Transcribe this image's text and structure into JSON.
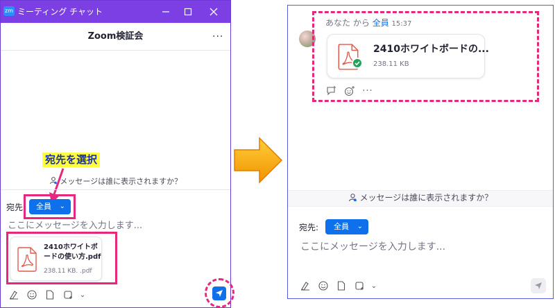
{
  "left_window": {
    "app_logo": "zm",
    "title": "ミーティング チャット",
    "window_controls": {
      "minimize": "–",
      "maximize": "□",
      "close": "✕"
    },
    "chat_title": "Zoom検証会",
    "more_menu": "···",
    "callout": "宛先を選択",
    "visibility_prompt": "メッセージは誰に表示されますか？",
    "to_label": "宛先:",
    "recipient": "全員",
    "input_placeholder": "ここにメッセージを入力します...",
    "file": {
      "name": "2410ホワイトボードの使い方.pdf",
      "meta": "238.11 KB. .pdf"
    }
  },
  "right_panel": {
    "sender": "あなた",
    "from": "から",
    "recipient": "全員",
    "time": "15:37",
    "file": {
      "name": "2410ホワイトボードの...",
      "meta": "238.11 KB"
    },
    "visibility_prompt": "メッセージは誰に表示されますか？",
    "to_label": "宛先:",
    "recipient_button": "全員",
    "input_placeholder": "ここにメッセージを入力します..."
  },
  "colors": {
    "titlebar": "#7b3fe4",
    "accent_blue": "#0e71eb",
    "highlight_pink": "#e6287d",
    "callout_yellow": "#ffff40",
    "arrow_orange": "#f5a300"
  },
  "icons": [
    "zoom-logo-icon",
    "minimize-icon",
    "maximize-icon",
    "close-icon",
    "more-icon",
    "pdf-icon",
    "person-icon",
    "chevron-down-icon",
    "format-icon",
    "emoji-icon",
    "file-icon",
    "screenshot-icon",
    "send-icon",
    "reply-icon",
    "reaction-icon",
    "check-icon"
  ]
}
